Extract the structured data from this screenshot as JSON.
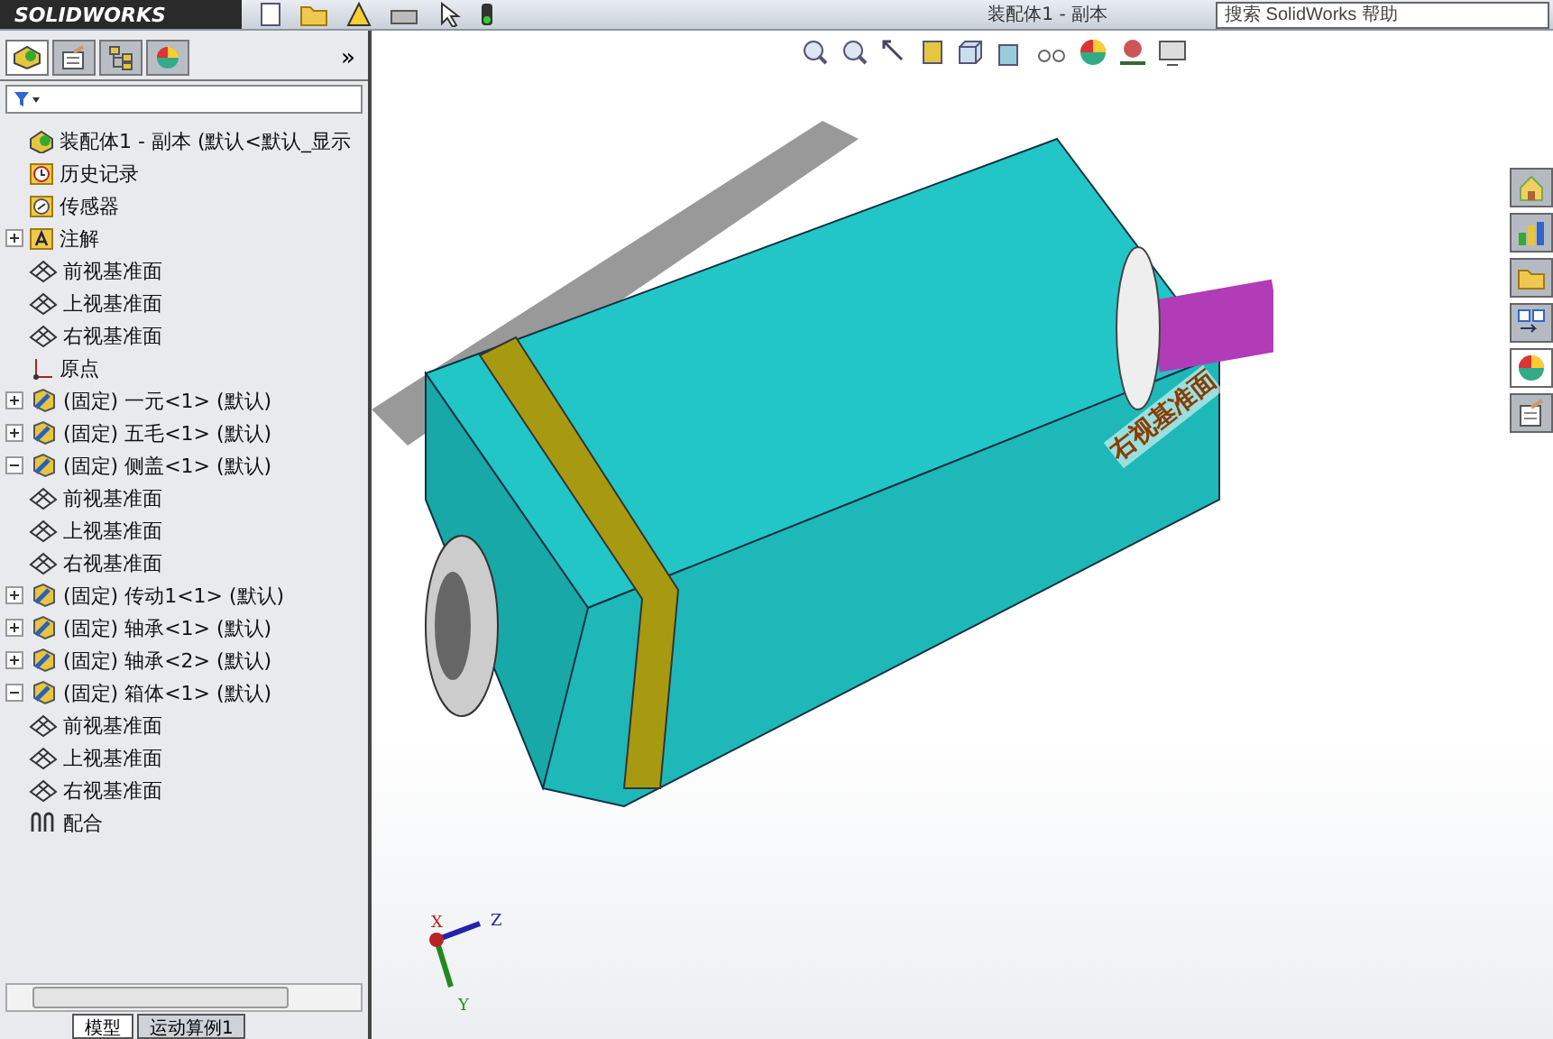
{
  "app": {
    "brand": "SOLIDWORKS",
    "document_title": "装配体1 - 副本",
    "search": {
      "placeholder": "搜索 SolidWorks 帮助"
    }
  },
  "panel_tabs": [
    {
      "kind": "feature",
      "selected": true
    },
    {
      "kind": "property",
      "selected": false
    },
    {
      "kind": "config",
      "selected": false
    },
    {
      "kind": "display",
      "selected": false
    }
  ],
  "panel_expand": "»",
  "tree": [
    {
      "kind": "assembly",
      "label": "装配体1 - 副本  (默认<默认_显示",
      "children": [
        {
          "kind": "history",
          "label": "历史记录"
        },
        {
          "kind": "sensor",
          "label": "传感器"
        },
        {
          "kind": "annotation",
          "label": "注解",
          "expanded": false
        },
        {
          "kind": "plane",
          "label": "前视基准面"
        },
        {
          "kind": "plane",
          "label": "上视基准面"
        },
        {
          "kind": "plane",
          "label": "右视基准面"
        },
        {
          "kind": "origin",
          "label": "原点"
        },
        {
          "kind": "part",
          "label": "(固定) 一元<1> (默认)",
          "expanded": false
        },
        {
          "kind": "part",
          "label": "(固定) 五毛<1> (默认)",
          "expanded": false
        },
        {
          "kind": "part",
          "label": "(固定) 侧盖<1> (默认)",
          "expanded": true,
          "children": [
            {
              "kind": "plane",
              "label": "前视基准面"
            },
            {
              "kind": "plane",
              "label": "上视基准面"
            },
            {
              "kind": "plane",
              "label": "右视基准面"
            }
          ]
        },
        {
          "kind": "part",
          "label": "(固定) 传动1<1> (默认)",
          "expanded": false
        },
        {
          "kind": "part",
          "label": "(固定) 轴承<1> (默认)",
          "expanded": false
        },
        {
          "kind": "part",
          "label": "(固定) 轴承<2> (默认)",
          "expanded": false
        },
        {
          "kind": "part",
          "label": "(固定) 箱体<1> (默认)",
          "expanded": true,
          "children": [
            {
              "kind": "plane",
              "label": "前视基准面"
            },
            {
              "kind": "plane",
              "label": "上视基准面"
            },
            {
              "kind": "plane",
              "label": "右视基准面"
            }
          ]
        },
        {
          "kind": "mates",
          "label": "配合"
        }
      ]
    }
  ],
  "bottom_tabs": [
    {
      "label": "模型",
      "selected": true
    },
    {
      "label": "运动算例1",
      "selected": false
    }
  ],
  "viewport": {
    "plane_label": "右视基准面",
    "triad": {
      "x": "X",
      "y": "Y",
      "z": "Z"
    }
  },
  "task_pane": [
    {
      "kind": "home",
      "selected": false
    },
    {
      "kind": "library",
      "selected": false
    },
    {
      "kind": "folder",
      "selected": false
    },
    {
      "kind": "palette",
      "selected": false
    },
    {
      "kind": "appearance",
      "selected": true
    },
    {
      "kind": "properties",
      "selected": false
    }
  ]
}
